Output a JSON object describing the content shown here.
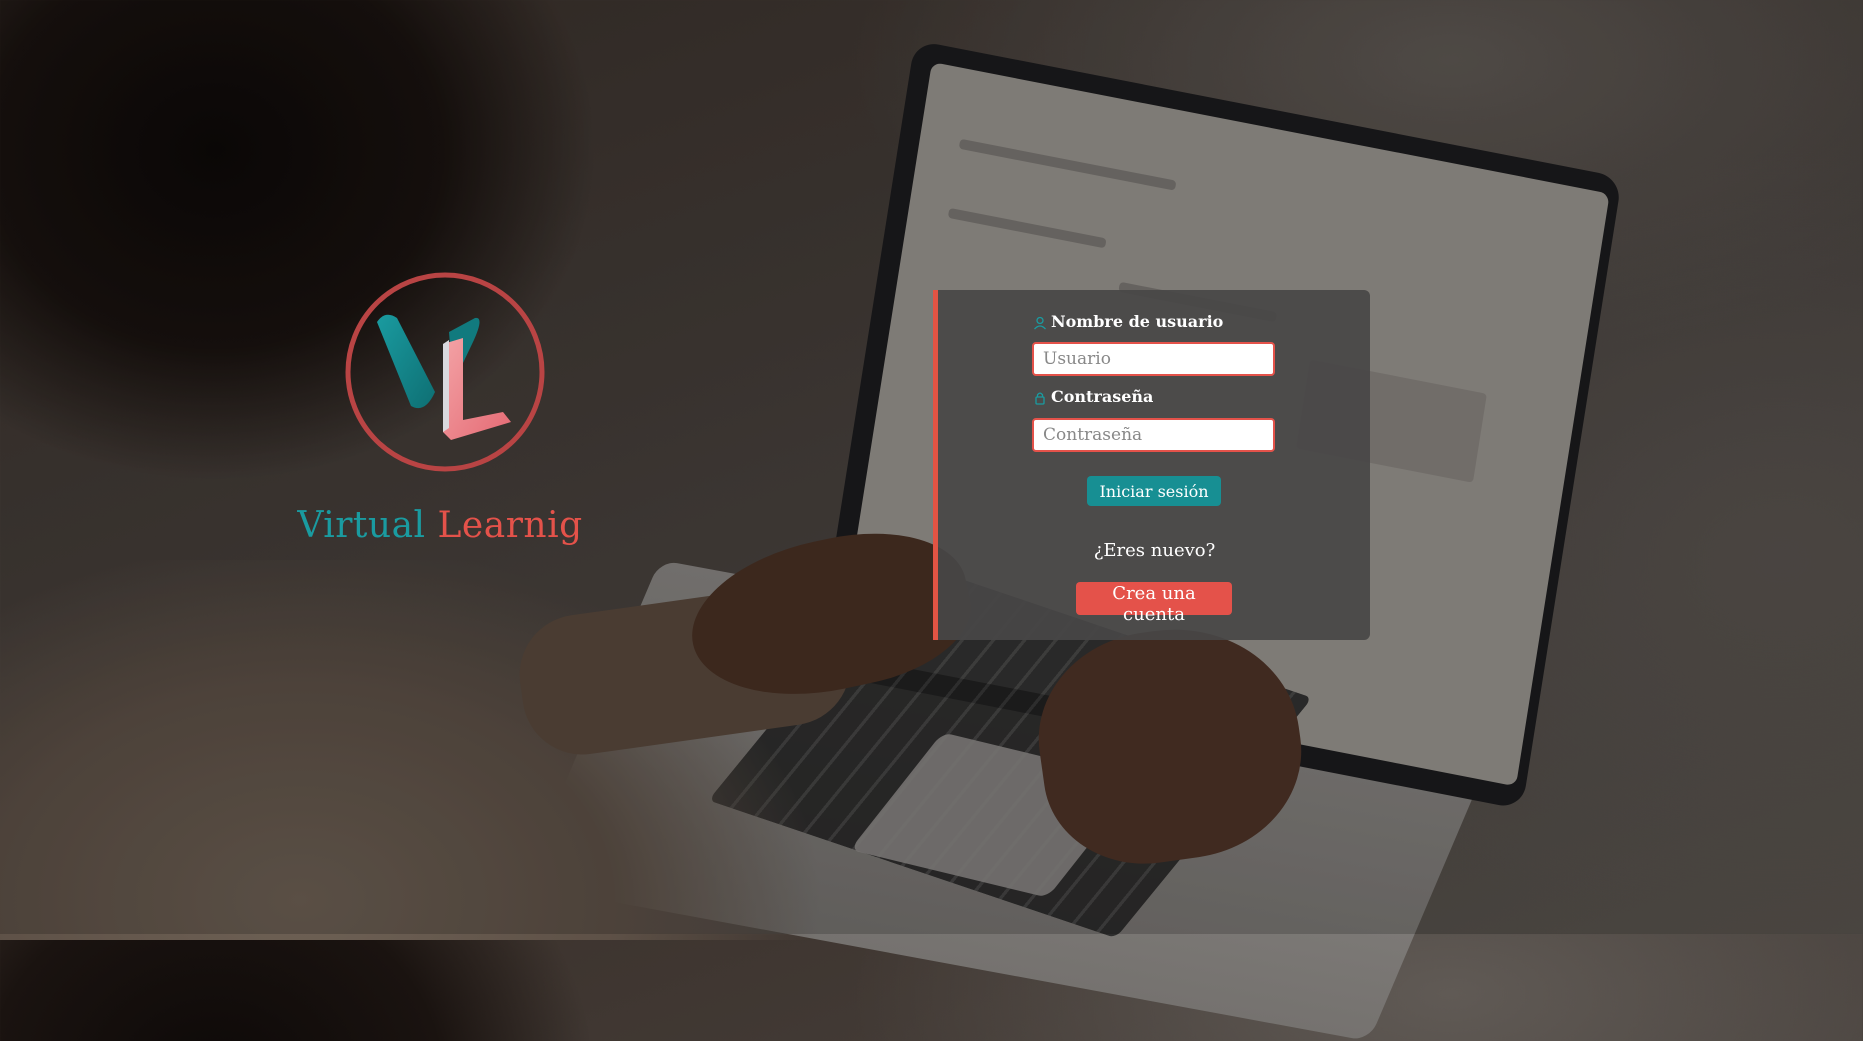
{
  "brand": {
    "word1": "Virtual",
    "word2": "Learnig",
    "logo_text": "VL",
    "colors": {
      "teal": "#1a9ba0",
      "coral": "#e4524a"
    }
  },
  "login": {
    "username_label": "Nombre de usuario",
    "username_placeholder": "Usuario",
    "password_label": "Contraseña",
    "password_placeholder": "Contraseña",
    "login_button": "Iniciar sesión",
    "new_user_prompt": "¿Eres nuevo?",
    "create_account_button": "Crea una cuenta"
  },
  "icons": {
    "username": "user-icon",
    "password": "lock-icon"
  },
  "colors": {
    "panel_accent": "#e25444",
    "login_button": "#178f93",
    "create_button": "#e4524a"
  }
}
